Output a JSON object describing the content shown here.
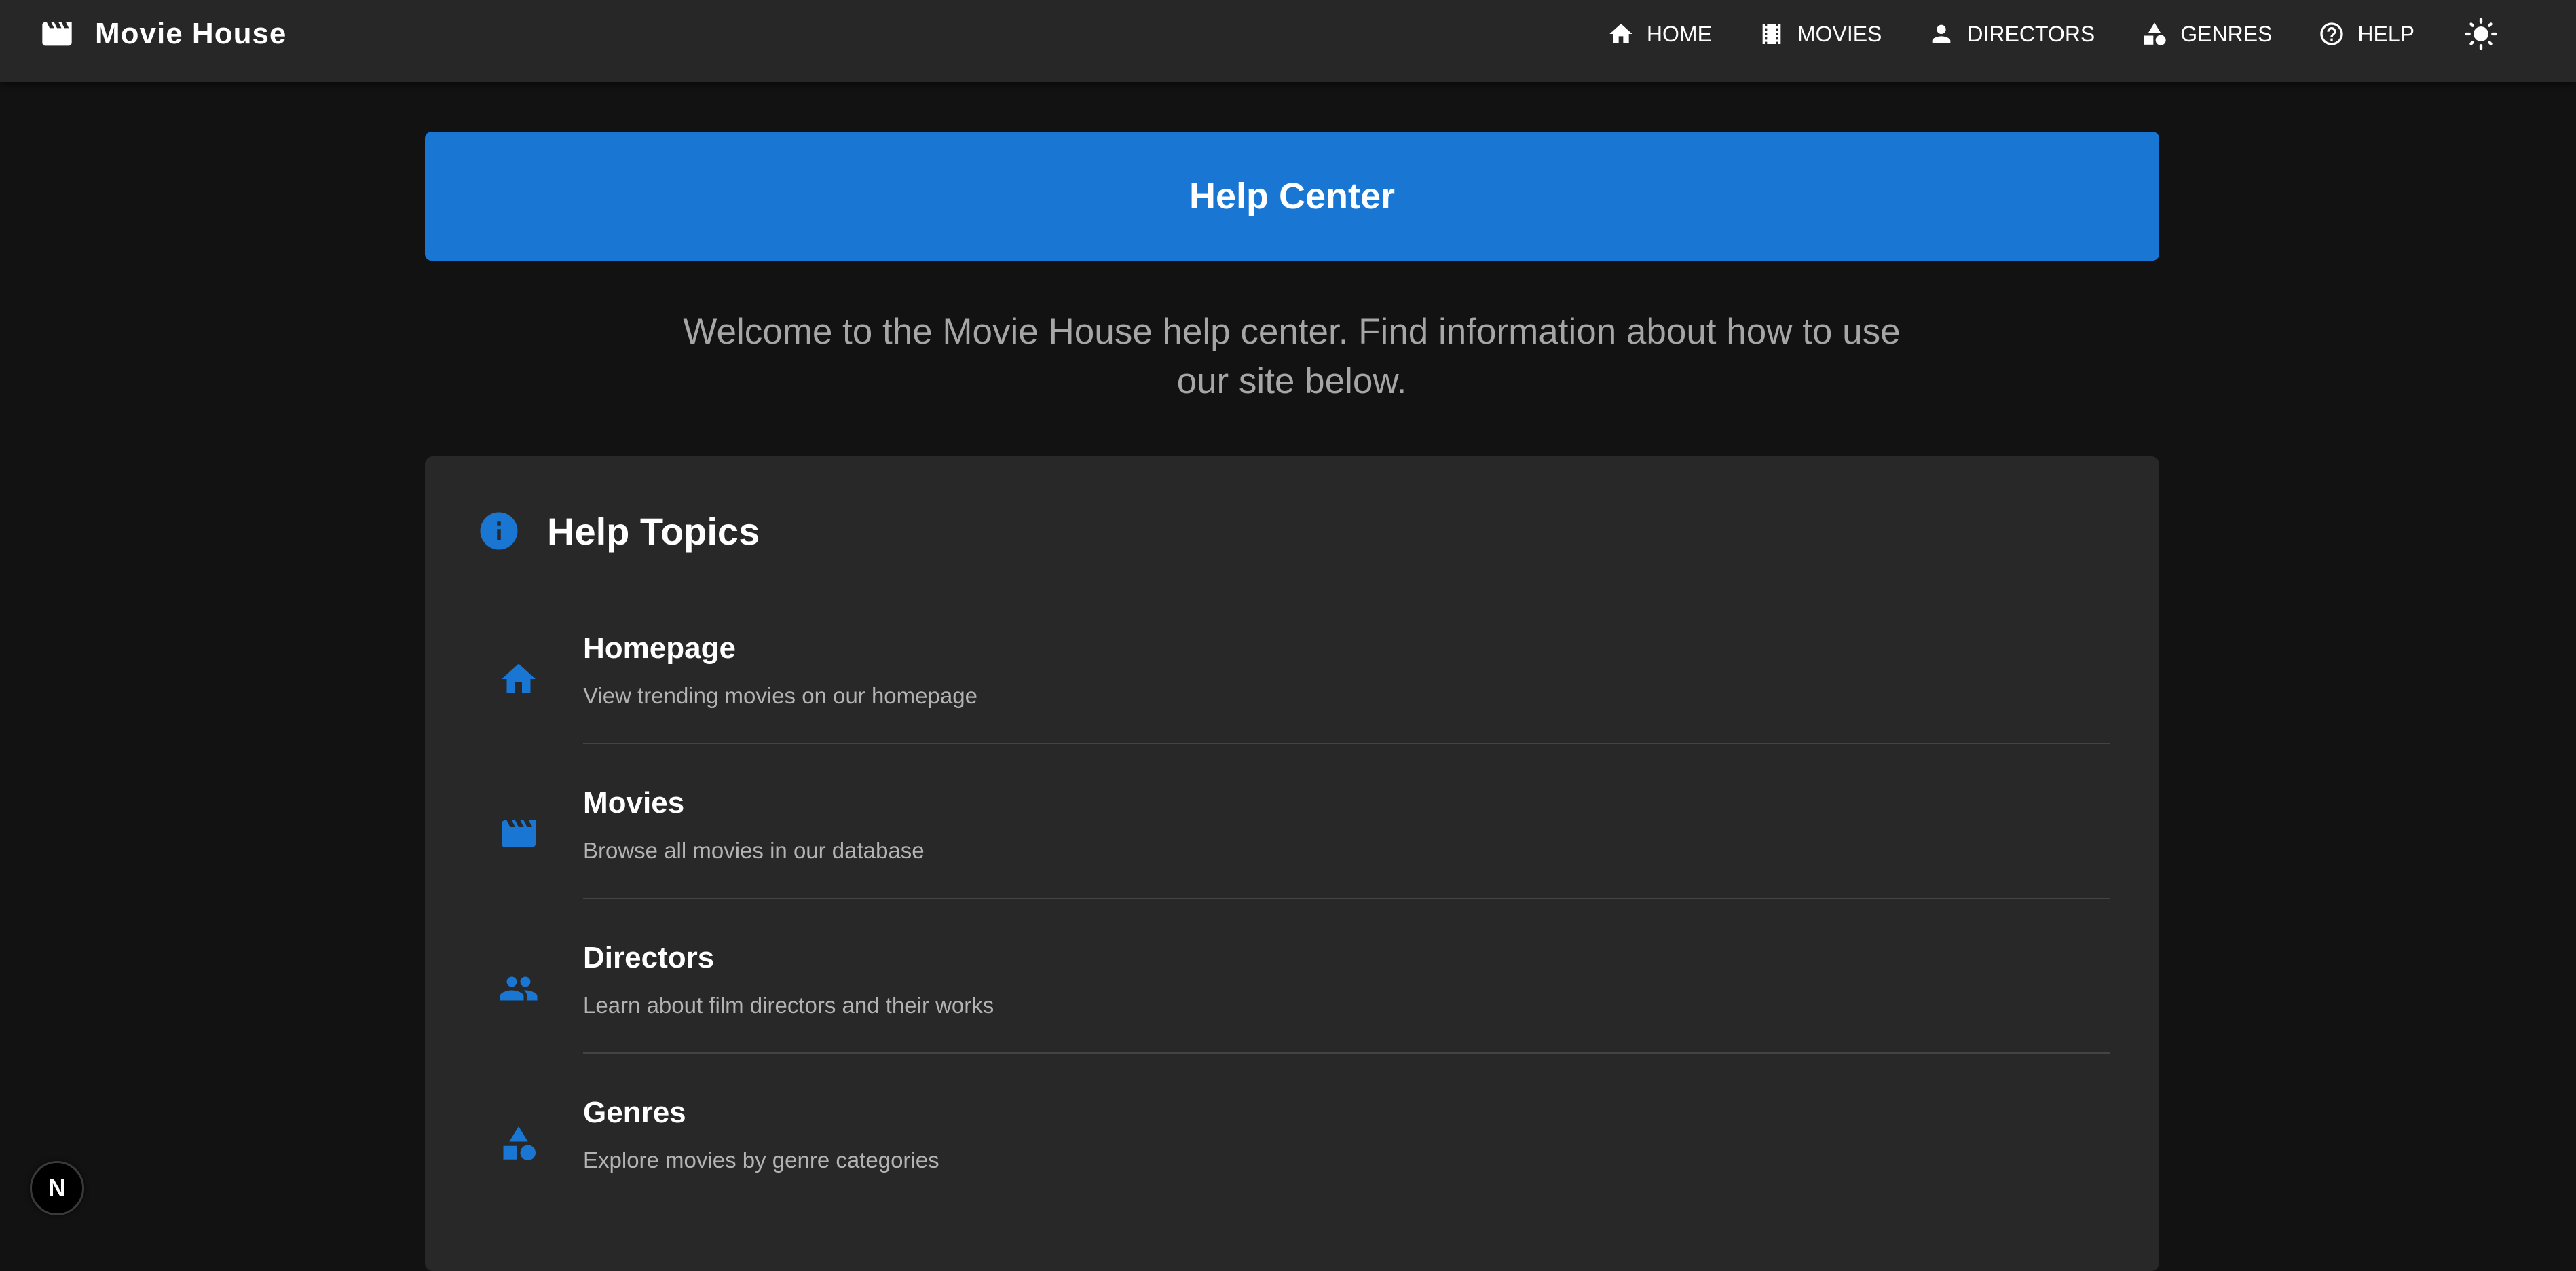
{
  "header": {
    "brand_name": "Movie House",
    "brand_icon": "clapperboard-icon",
    "nav": [
      {
        "label": "HOME",
        "icon": "home-icon"
      },
      {
        "label": "MOVIES",
        "icon": "film-icon"
      },
      {
        "label": "DIRECTORS",
        "icon": "person-icon"
      },
      {
        "label": "GENRES",
        "icon": "shapes-icon"
      },
      {
        "label": "HELP",
        "icon": "help-circle-icon"
      }
    ],
    "theme_toggle_icon": "sun-icon"
  },
  "banner": {
    "title": "Help Center"
  },
  "intro": "Welcome to the Movie House help center. Find information about how to use our site below.",
  "topics_card": {
    "title": "Help Topics",
    "icon": "info-icon",
    "items": [
      {
        "title": "Homepage",
        "description": "View trending movies on our homepage",
        "icon": "home-icon"
      },
      {
        "title": "Movies",
        "description": "Browse all movies in our database",
        "icon": "clapperboard-icon"
      },
      {
        "title": "Directors",
        "description": "Learn about film directors and their works",
        "icon": "people-icon"
      },
      {
        "title": "Genres",
        "description": "Explore movies by genre categories",
        "icon": "shapes-icon"
      }
    ]
  },
  "dev_badge": {
    "label": "N"
  },
  "colors": {
    "background": "#121212",
    "appbar": "#272727",
    "primary": "#1976d2",
    "card": "#282828",
    "muted_text": "#a6a6a6"
  }
}
